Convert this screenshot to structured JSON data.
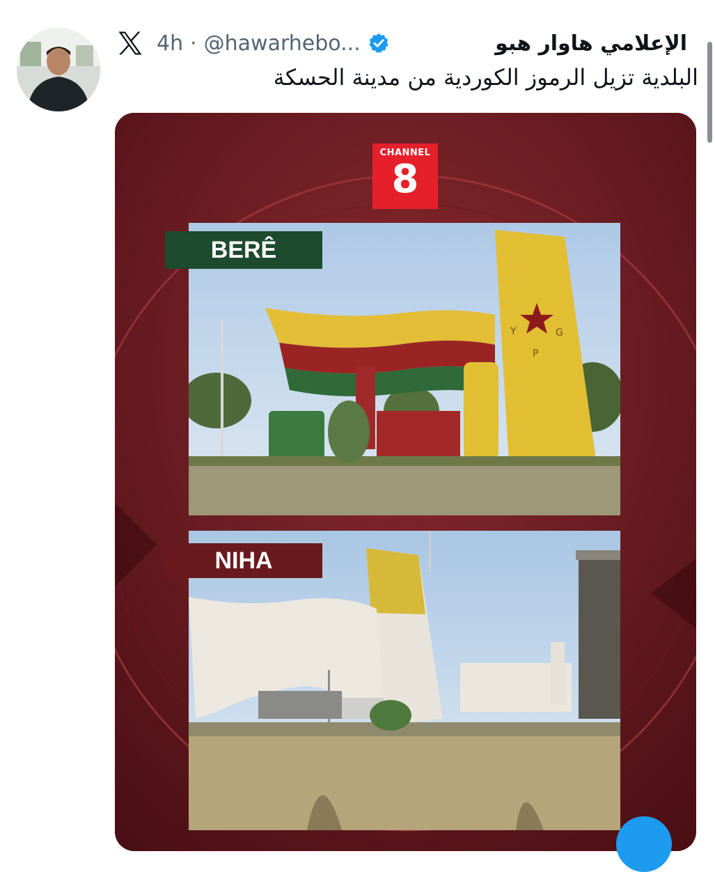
{
  "tweet": {
    "author_name": "الإعلامي هاوار هبو",
    "handle": "@hawarhebo...",
    "separator": "·",
    "time": "4h",
    "text": "البلدية تزيل الرموز الكوردية من مدينة الحسكة"
  },
  "media": {
    "channel_label": "CHANNEL",
    "channel_number": "8",
    "label_top": "BERÊ",
    "label_bottom": "NIHA",
    "monument_letters": [
      "Y",
      "G",
      "P"
    ]
  },
  "icons": {
    "x_logo": "x-logo-icon",
    "verified": "verified-badge-icon"
  },
  "colors": {
    "verified": "#1d9bf0",
    "background_maroon": "#5a1418",
    "channel_red": "#e5202a",
    "label_green": "#1e4a2e",
    "label_maroon": "#6a1a1f"
  }
}
